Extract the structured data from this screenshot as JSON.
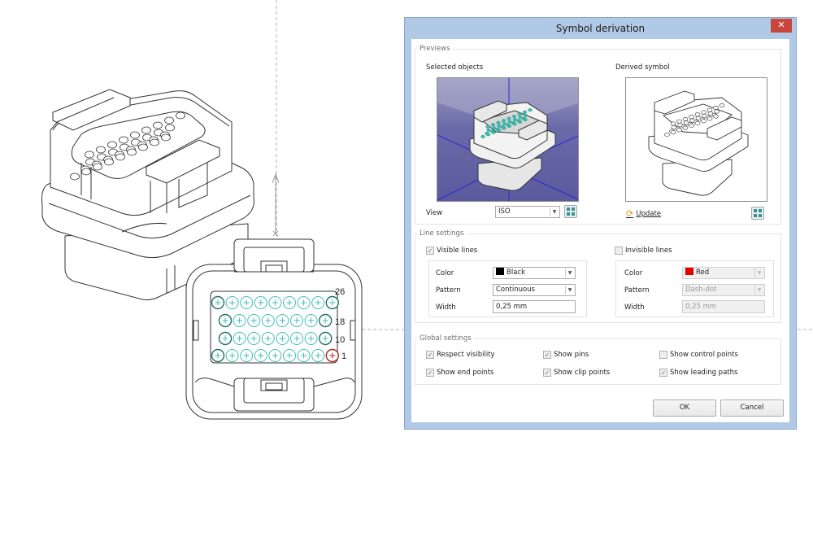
{
  "dialog": {
    "title": "Symbol derivation",
    "close_icon": "close-icon",
    "previews": {
      "group_label": "Previews",
      "selected_objects_label": "Selected objects",
      "derived_symbol_label": "Derived symbol",
      "view_label": "View",
      "view_value": "ISO",
      "fit_icon": "zoom-fit-icon",
      "update_label": "Update",
      "update_icon": "refresh-icon"
    },
    "line_settings": {
      "group_label": "Line settings",
      "visible": {
        "label": "Visible lines",
        "checked": true,
        "color_label": "Color",
        "color_value": "Black",
        "color_hex": "#000000",
        "pattern_label": "Pattern",
        "pattern_value": "Continuous",
        "width_label": "Width",
        "width_value": "0,25 mm"
      },
      "invisible": {
        "label": "Invisible lines",
        "checked": false,
        "color_label": "Color",
        "color_value": "Red",
        "color_hex": "#e00000",
        "pattern_label": "Pattern",
        "pattern_value": "Dash-dot",
        "width_label": "Width",
        "width_value": "0,25 mm"
      }
    },
    "global_settings": {
      "group_label": "Global settings",
      "options": [
        {
          "label": "Respect visibility",
          "checked": true
        },
        {
          "label": "Show pins",
          "checked": true
        },
        {
          "label": "Show control points",
          "checked": false
        },
        {
          "label": "Show end points",
          "checked": true
        },
        {
          "label": "Show clip points",
          "checked": true
        },
        {
          "label": "Show leading paths",
          "checked": true
        }
      ]
    },
    "buttons": {
      "ok": "OK",
      "cancel": "Cancel"
    }
  },
  "drawing": {
    "pin_labels": [
      "26",
      "18",
      "10",
      "1"
    ],
    "pin_rows": [
      9,
      8,
      8,
      9
    ],
    "pin_color": "#3fbfb0",
    "pin1_color": "#b02020"
  }
}
